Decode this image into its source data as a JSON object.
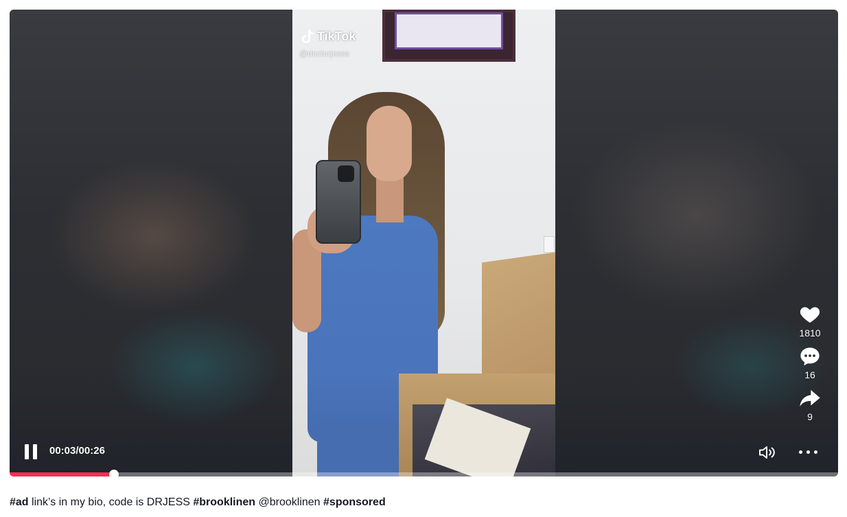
{
  "watermark": {
    "brand": "TikTok",
    "handle": "@doctorjesss"
  },
  "actions": {
    "likes": "1810",
    "comments": "16",
    "shares": "9"
  },
  "player": {
    "current_time": "00:03",
    "duration": "00:26",
    "time_separator": "/",
    "progress_fraction": 0.126,
    "progress_color": "#fe2c55"
  },
  "caption": {
    "tag_ad": "#ad",
    "text1": " link’s in my bio, code is DRJESS ",
    "tag_brooklinen": "#brooklinen",
    "mention": " @brooklinen ",
    "tag_sponsored": "#sponsored"
  },
  "icons": [
    "tiktok-logo-icon",
    "heart-icon",
    "comment-icon",
    "share-icon",
    "pause-icon",
    "volume-icon",
    "more-icon"
  ]
}
